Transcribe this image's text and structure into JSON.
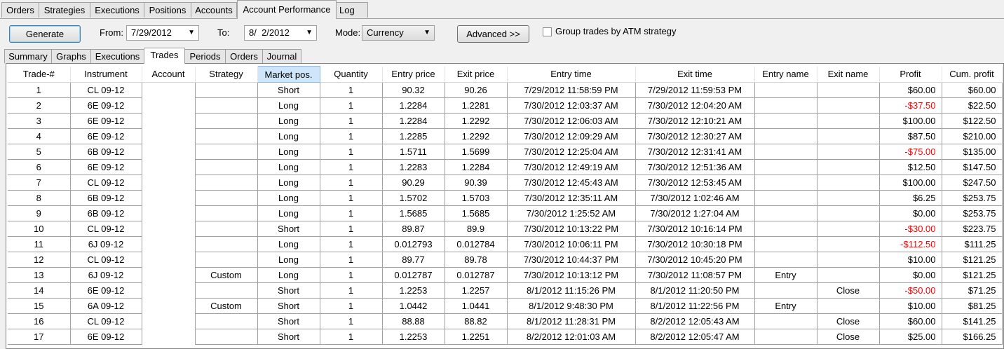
{
  "top_tabs": [
    "Orders",
    "Strategies",
    "Executions",
    "Positions",
    "Accounts",
    "Account Performance",
    "Log"
  ],
  "active_top_tab": "Account Performance",
  "toolbar": {
    "generate_label": "Generate",
    "from_label": "From:",
    "from_value": "7/29/2012",
    "to_label": "To:",
    "to_value": "8/  2/2012",
    "mode_label": "Mode:",
    "mode_value": "Currency",
    "advanced_label": "Advanced >>",
    "group_checkbox_label": "Group trades by ATM strategy",
    "group_checked": false
  },
  "sub_tabs": [
    "Summary",
    "Graphs",
    "Executions",
    "Trades",
    "Periods",
    "Orders",
    "Journal"
  ],
  "active_sub_tab": "Trades",
  "negative_color": "#ff0000",
  "table": {
    "sorted_column": "Market pos.",
    "columns": [
      "Trade-#",
      "Instrument",
      "Account",
      "Strategy",
      "Market pos.",
      "Quantity",
      "Entry price",
      "Exit price",
      "Entry time",
      "Exit time",
      "Entry name",
      "Exit name",
      "Profit",
      "Cum. profit"
    ],
    "rows": [
      [
        "1",
        "CL 09-12",
        "",
        "",
        "Short",
        "1",
        "90.32",
        "90.26",
        "7/29/2012 11:58:59 PM",
        "7/29/2012 11:59:53 PM",
        "",
        "",
        "$60.00",
        "$60.00"
      ],
      [
        "2",
        "6E 09-12",
        "",
        "",
        "Long",
        "1",
        "1.2284",
        "1.2281",
        "7/30/2012 12:03:37 AM",
        "7/30/2012 12:04:20 AM",
        "",
        "",
        "-$37.50",
        "$22.50"
      ],
      [
        "3",
        "6E 09-12",
        "",
        "",
        "Long",
        "1",
        "1.2284",
        "1.2292",
        "7/30/2012 12:06:03 AM",
        "7/30/2012 12:10:21 AM",
        "",
        "",
        "$100.00",
        "$122.50"
      ],
      [
        "4",
        "6E 09-12",
        "",
        "",
        "Long",
        "1",
        "1.2285",
        "1.2292",
        "7/30/2012 12:09:29 AM",
        "7/30/2012 12:30:27 AM",
        "",
        "",
        "$87.50",
        "$210.00"
      ],
      [
        "5",
        "6B 09-12",
        "",
        "",
        "Long",
        "1",
        "1.5711",
        "1.5699",
        "7/30/2012 12:25:04 AM",
        "7/30/2012 12:31:41 AM",
        "",
        "",
        "-$75.00",
        "$135.00"
      ],
      [
        "6",
        "6E 09-12",
        "",
        "",
        "Long",
        "1",
        "1.2283",
        "1.2284",
        "7/30/2012 12:49:19 AM",
        "7/30/2012 12:51:36 AM",
        "",
        "",
        "$12.50",
        "$147.50"
      ],
      [
        "7",
        "CL 09-12",
        "",
        "",
        "Long",
        "1",
        "90.29",
        "90.39",
        "7/30/2012 12:45:43 AM",
        "7/30/2012 12:53:45 AM",
        "",
        "",
        "$100.00",
        "$247.50"
      ],
      [
        "8",
        "6B 09-12",
        "",
        "",
        "Long",
        "1",
        "1.5702",
        "1.5703",
        "7/30/2012 12:35:11 AM",
        "7/30/2012 1:02:46 AM",
        "",
        "",
        "$6.25",
        "$253.75"
      ],
      [
        "9",
        "6B 09-12",
        "",
        "",
        "Long",
        "1",
        "1.5685",
        "1.5685",
        "7/30/2012 1:25:52 AM",
        "7/30/2012 1:27:04 AM",
        "",
        "",
        "$0.00",
        "$253.75"
      ],
      [
        "10",
        "CL 09-12",
        "",
        "",
        "Short",
        "1",
        "89.87",
        "89.9",
        "7/30/2012 10:13:22 PM",
        "7/30/2012 10:16:14 PM",
        "",
        "",
        "-$30.00",
        "$223.75"
      ],
      [
        "11",
        "6J 09-12",
        "",
        "",
        "Long",
        "1",
        "0.012793",
        "0.012784",
        "7/30/2012 10:06:11 PM",
        "7/30/2012 10:30:18 PM",
        "",
        "",
        "-$112.50",
        "$111.25"
      ],
      [
        "12",
        "CL 09-12",
        "",
        "",
        "Long",
        "1",
        "89.77",
        "89.78",
        "7/30/2012 10:44:37 PM",
        "7/30/2012 10:45:20 PM",
        "",
        "",
        "$10.00",
        "$121.25"
      ],
      [
        "13",
        "6J 09-12",
        "",
        "Custom",
        "Long",
        "1",
        "0.012787",
        "0.012787",
        "7/30/2012 10:13:12 PM",
        "7/30/2012 11:08:57 PM",
        "Entry",
        "",
        "$0.00",
        "$121.25"
      ],
      [
        "14",
        "6E 09-12",
        "",
        "",
        "Short",
        "1",
        "1.2253",
        "1.2257",
        "8/1/2012 11:15:26 PM",
        "8/1/2012 11:20:50 PM",
        "",
        "Close",
        "-$50.00",
        "$71.25"
      ],
      [
        "15",
        "6A 09-12",
        "",
        "Custom",
        "Short",
        "1",
        "1.0442",
        "1.0441",
        "8/1/2012 9:48:30 PM",
        "8/1/2012 11:22:56 PM",
        "Entry",
        "",
        "$10.00",
        "$81.25"
      ],
      [
        "16",
        "CL 09-12",
        "",
        "",
        "Short",
        "1",
        "88.88",
        "88.82",
        "8/1/2012 11:28:31 PM",
        "8/2/2012 12:05:43 AM",
        "",
        "Close",
        "$60.00",
        "$141.25"
      ],
      [
        "17",
        "6E 09-12",
        "",
        "",
        "Short",
        "1",
        "1.2253",
        "1.2251",
        "8/2/2012 12:01:03 AM",
        "8/2/2012 12:05:47 AM",
        "",
        "Close",
        "$25.00",
        "$166.25"
      ]
    ]
  }
}
